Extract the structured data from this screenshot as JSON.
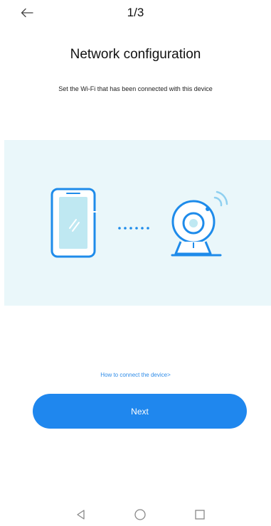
{
  "header": {
    "back_icon": "arrow-left-icon",
    "step": "1/3"
  },
  "main": {
    "title": "Network configuration",
    "subtitle": "Set the Wi-Fi that has been connected with this device",
    "illustration": {
      "left_icon": "phone-icon",
      "middle_icon": "dotted-link-icon",
      "right_icon": "camera-wifi-icon"
    },
    "help_link": "How to connect the device>",
    "next_label": "Next"
  },
  "system_nav": {
    "back_icon": "triangle-back-icon",
    "home_icon": "circle-home-icon",
    "recents_icon": "square-recents-icon"
  },
  "colors": {
    "accent": "#1F87EE",
    "link": "#2D8BE8",
    "illustration_bg": "#EAF7FA",
    "device_outline": "#1E8BEA",
    "phone_screen": "#BFE8F2"
  }
}
